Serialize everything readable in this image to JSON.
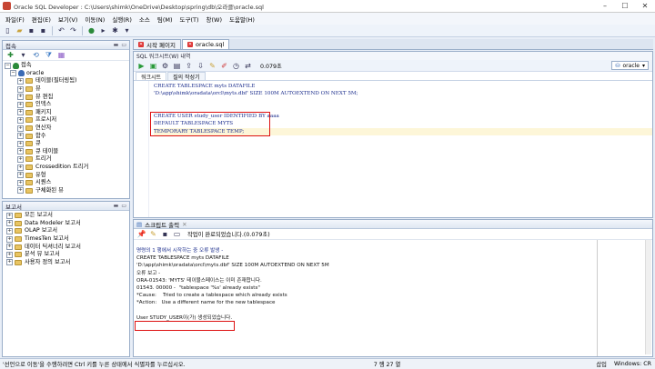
{
  "window": {
    "title": "Oracle SQL Developer : C:\\Users\\shimk\\OneDrive\\Desktop\\spring\\db\\오라클\\oracle.sql"
  },
  "menu": [
    "파일(F)",
    "편집(E)",
    "보기(V)",
    "이동(N)",
    "실행(R)",
    "소스",
    "팀(M)",
    "도구(T)",
    "창(W)",
    "도움말(H)"
  ],
  "connections": {
    "title": "접속",
    "root": "접속",
    "db": "oracle",
    "nodes": [
      "테이블(필터링됨)",
      "뷰",
      "뷰 편집",
      "인덱스",
      "패키지",
      "프로시저",
      "연산자",
      "함수",
      "큐",
      "큐 테이블",
      "트리거",
      "Crossedition 트리거",
      "유형",
      "시퀀스",
      "구체화된 뷰"
    ]
  },
  "reports": {
    "title": "보고서",
    "nodes": [
      "모든 보고서",
      "Data Modeler 보고서",
      "OLAP 보고서",
      "TimesTen 보고서",
      "데이터 딕셔너리 보고서",
      "분석 뷰 보고서",
      "사용자 정의 보고서"
    ]
  },
  "tabs": [
    {
      "label": "시작 페이지"
    },
    {
      "label": "oracle.sql"
    }
  ],
  "worksheet": {
    "header": "SQL 워크시트(W)   내역",
    "elapsed": "0.079초",
    "connection": "oracle",
    "subtabs": [
      "워크시트",
      "질의 작성기"
    ],
    "lines": [
      "CREATE TABLESPACE myts DATAFILE",
      "'D:\\app\\shimk\\oradata\\orcl\\myts.dbf' SIZE 100M AUTOEXTEND ON NEXT 5M;",
      "",
      "",
      "CREATE USER study_user IDENTIFIED BY aaaa",
      "DEFAULT TABLESPACE MYTS",
      "TEMPORARY TABLESPACE TEMP;"
    ]
  },
  "script_output": {
    "title": "스크립트 출력",
    "message": "작업이 완료되었습니다.(0.079초)",
    "lines": [
      "명령의 1 행에서 시작하는 중 오류 발생 -",
      "CREATE TABLESPACE myts DATAFILE",
      "'D:\\app\\shimk\\oradata\\orcl\\myts.dbf' SIZE 100M AUTOEXTEND ON NEXT 5M",
      "오류 보고 -",
      "ORA-01543: 'MYTS' 테이블스페이스는 이미 존재합니다.",
      "01543. 00000 -  \"tablespace '%s' already exists\"",
      "*Cause:    Tried to create a tablespace which already exists",
      "*Action:   Use a different name for the new tablespace",
      "",
      "User STUDY_USER이(가) 생성되었습니다."
    ]
  },
  "status": {
    "hint": "'선언으로 이동'을 수행하려면 Ctrl 키를 누른 상태에서 식별자를 누르십시오.",
    "position": "7 행 27 열",
    "mode": "삽입",
    "crlf": "Windows: CR"
  }
}
